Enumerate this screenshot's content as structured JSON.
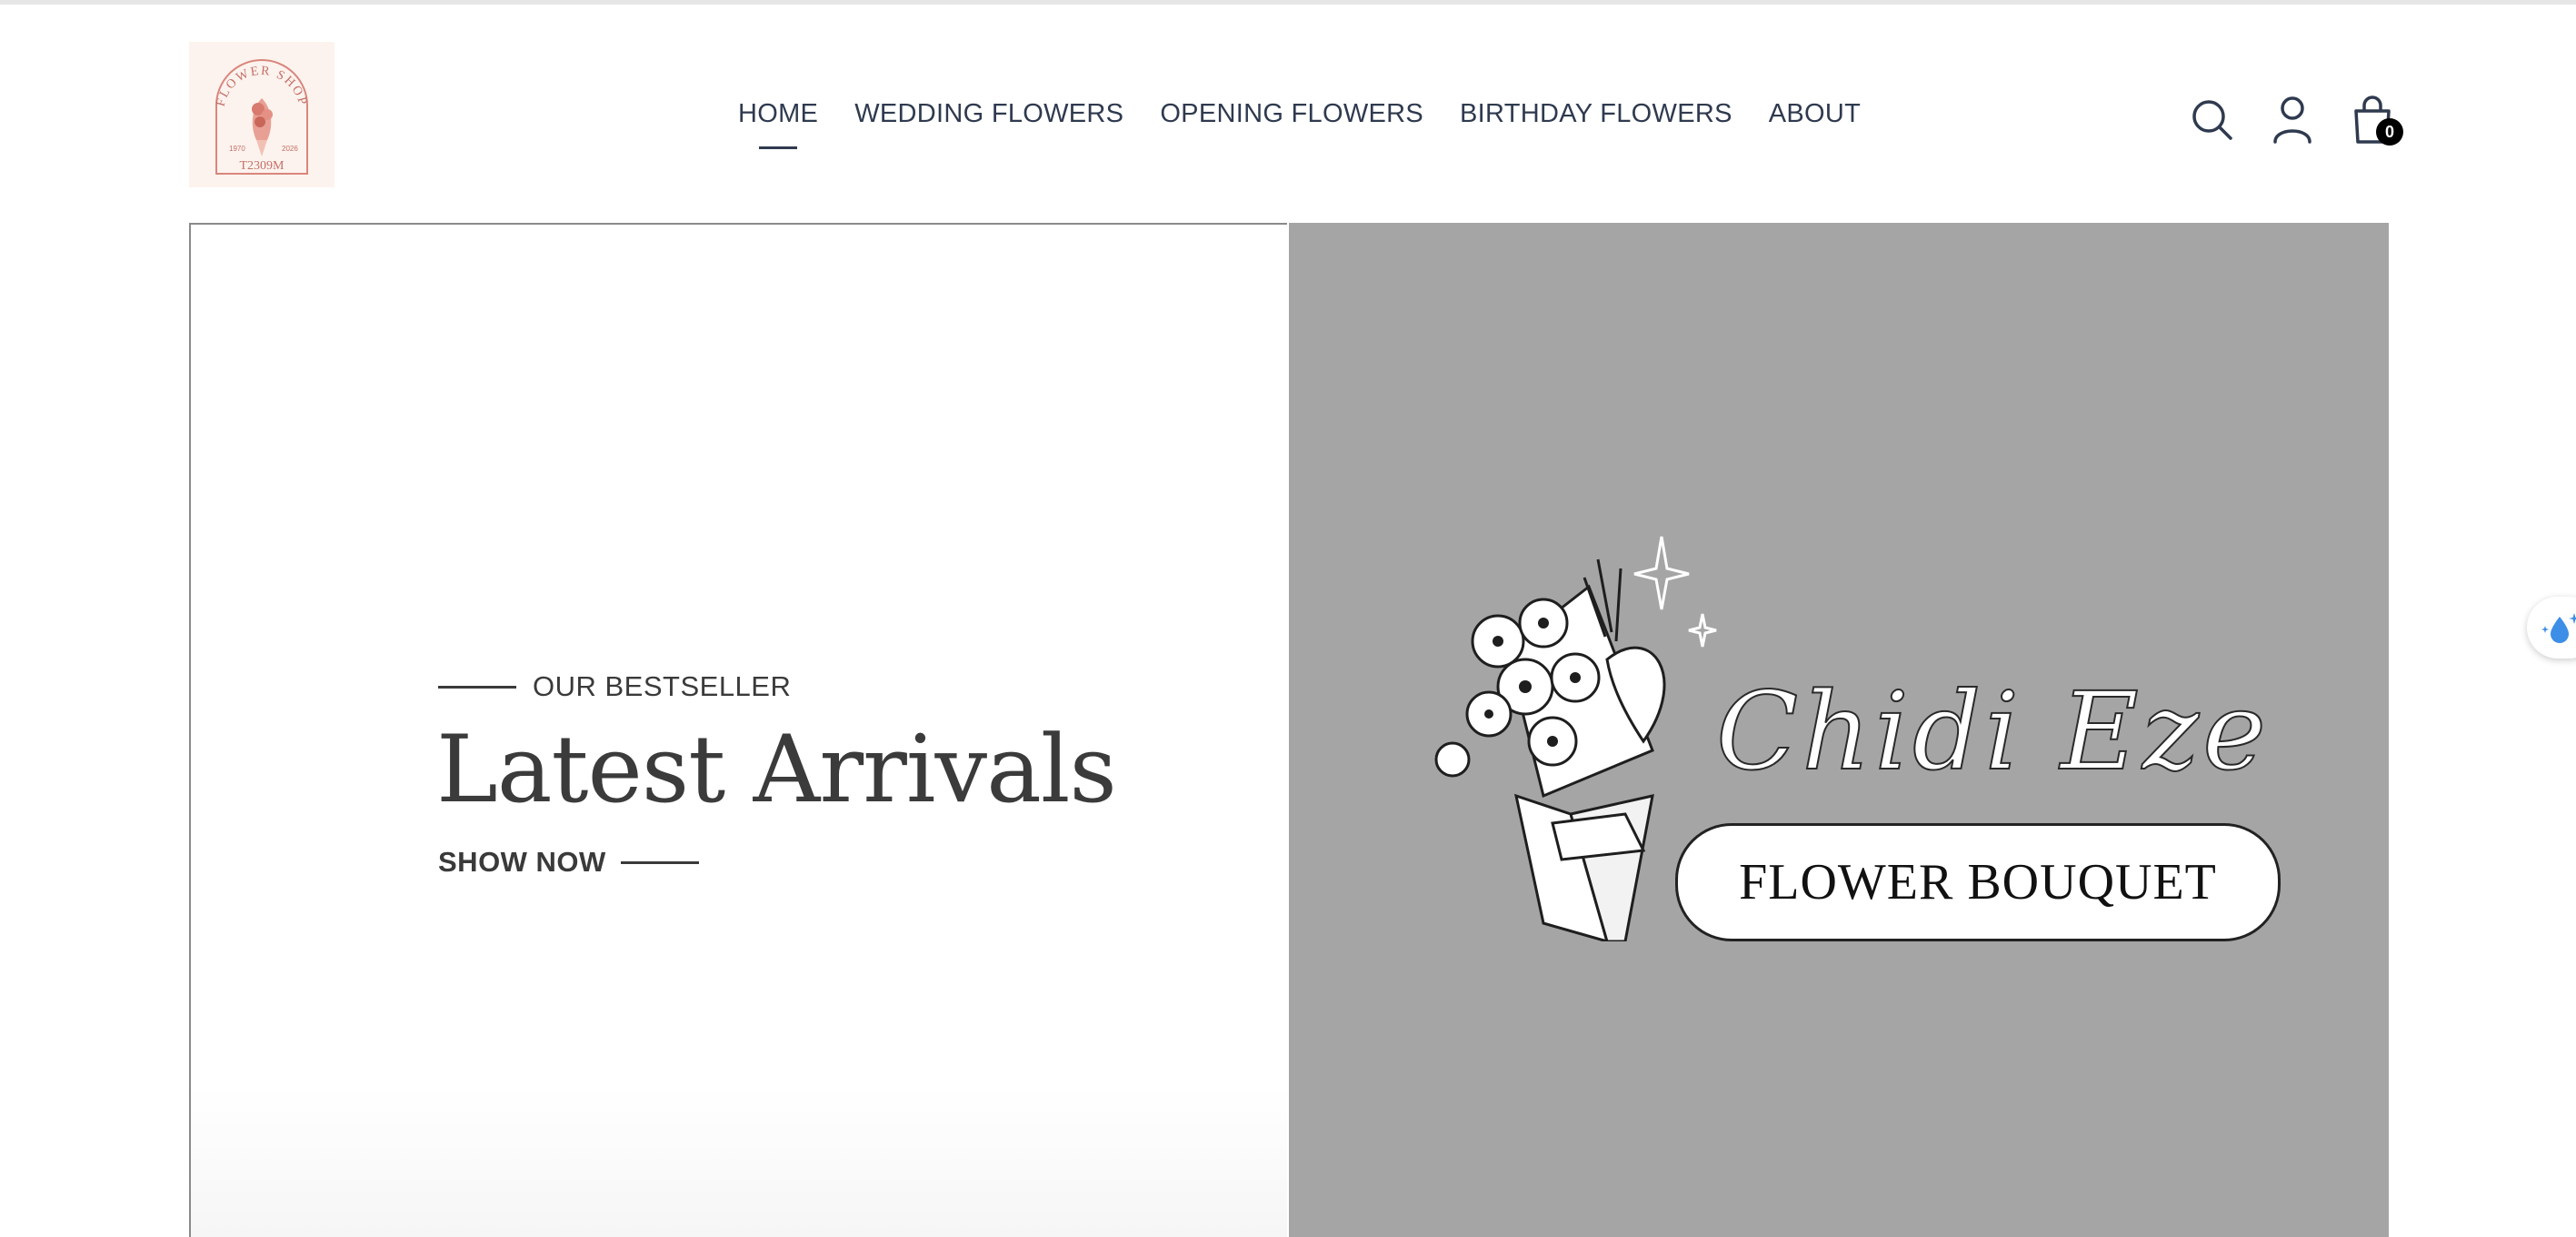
{
  "logo": {
    "arc_text": "FLOWER SHOP",
    "left_year": "1970",
    "right_year": "2026",
    "name": "T2309M"
  },
  "nav": {
    "items": [
      {
        "label": "HOME"
      },
      {
        "label": "WEDDING FLOWERS"
      },
      {
        "label": "OPENING FLOWERS"
      },
      {
        "label": "BIRTHDAY FLOWERS"
      },
      {
        "label": "ABOUT"
      }
    ]
  },
  "header_icons": {
    "search": "search-icon",
    "account": "user-icon",
    "cart": "shopping-bag-icon",
    "cart_count": "0"
  },
  "hero": {
    "eyebrow": "OUR BESTSELLER",
    "title": "Latest Arrivals",
    "cta": "SHOW NOW",
    "brand_name": "Chidi Eze",
    "brand_tagline": "FLOWER BOUQUET",
    "panel_color": "#a5a5a5"
  },
  "colors": {
    "nav_text": "#2f3a4f",
    "hero_text": "#3b3b3b",
    "logo_bg": "#fdf3ee",
    "logo_accent": "#d9867c"
  }
}
